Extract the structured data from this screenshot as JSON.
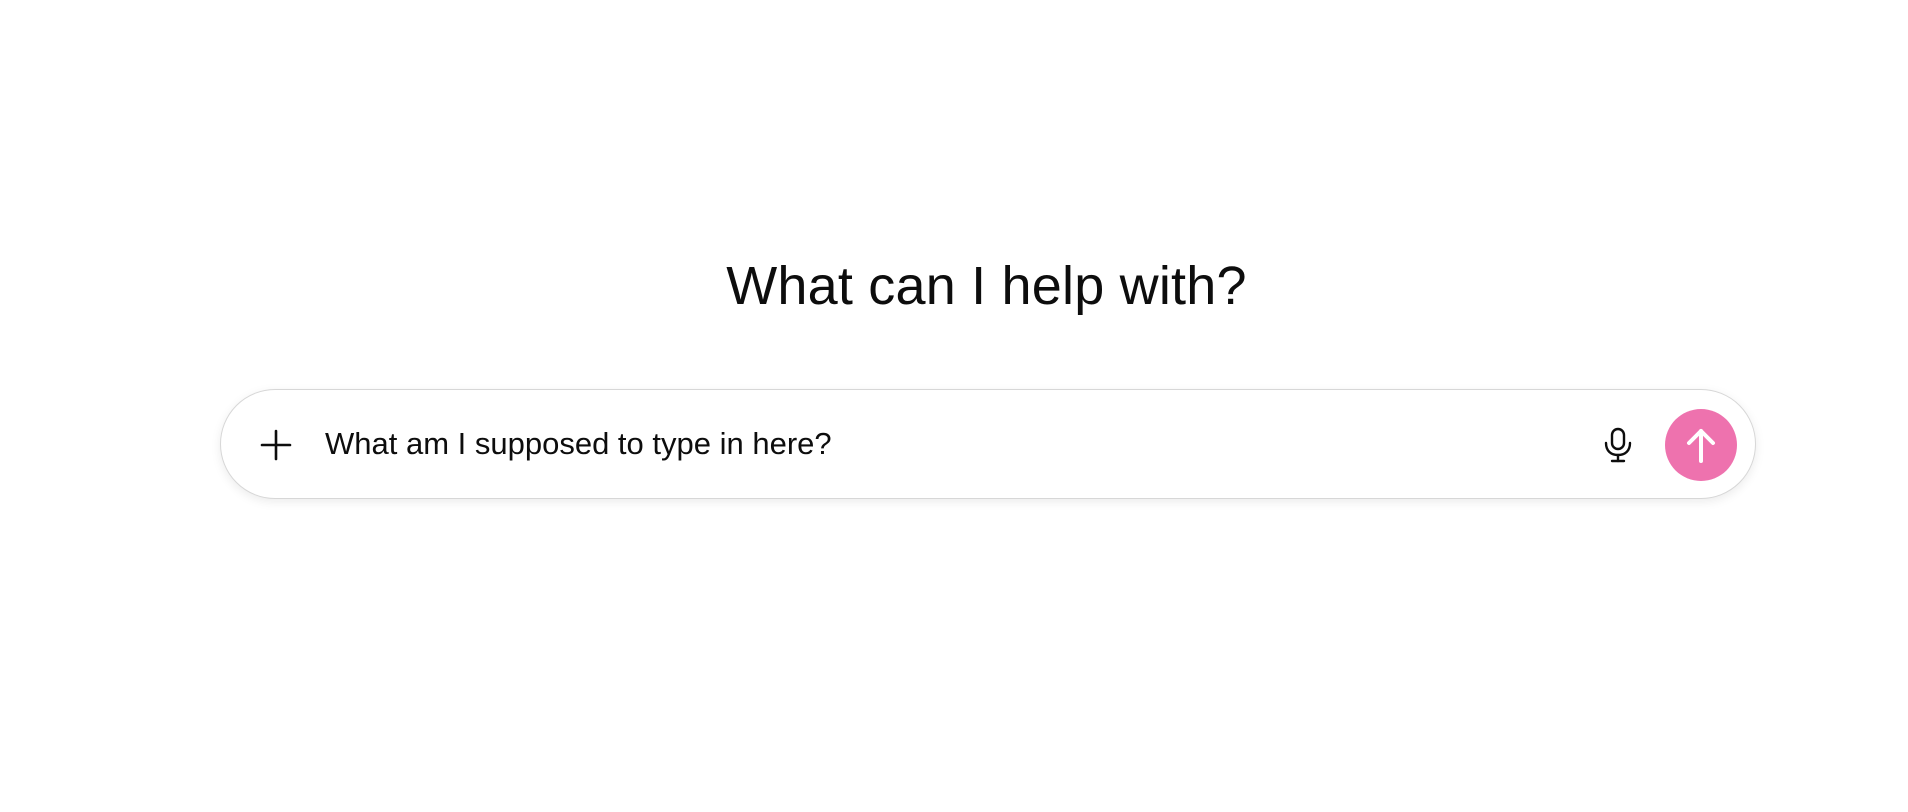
{
  "page": {
    "heading": "What can I help with?"
  },
  "composer": {
    "input_value": "What am I supposed to type in here?",
    "icons": {
      "add": "plus-icon",
      "voice": "microphone-icon",
      "send": "arrow-up-icon"
    },
    "colors": {
      "send_button_bg": "#ee72ae",
      "send_icon": "#ffffff",
      "border": "#d7d7d7"
    }
  }
}
